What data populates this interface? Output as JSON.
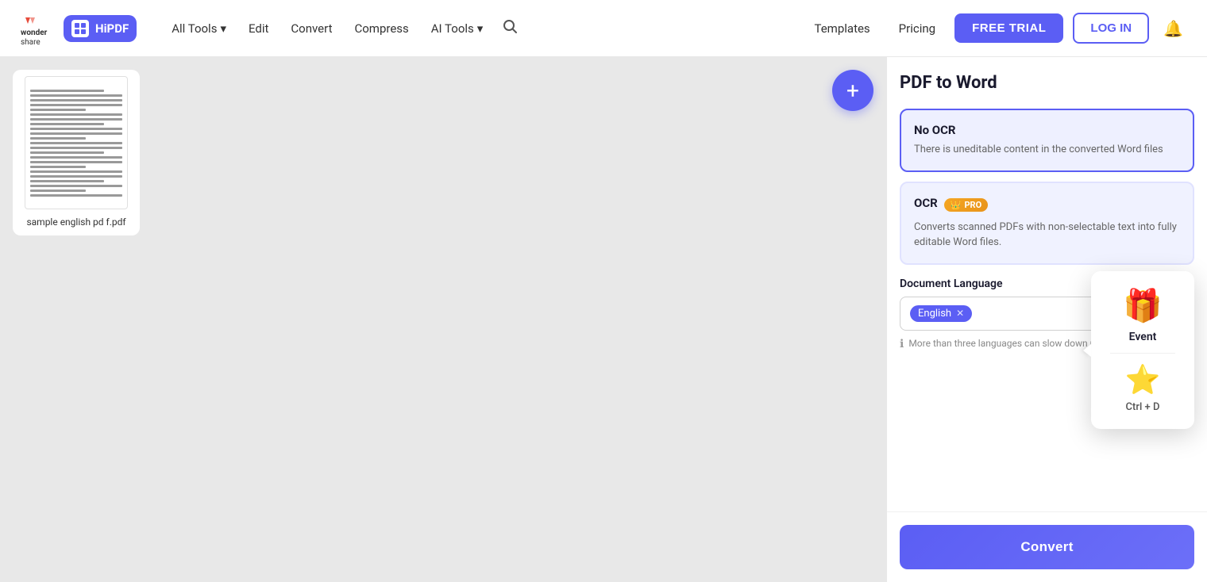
{
  "header": {
    "logo_ws_text": "wondershare",
    "logo_hipdf_text": "HiPDF",
    "nav": {
      "all_tools": "All Tools",
      "edit": "Edit",
      "convert": "Convert",
      "compress": "Compress",
      "ai_tools": "AI Tools"
    },
    "right": {
      "templates": "Templates",
      "pricing": "Pricing",
      "free_trial": "FREE TRIAL",
      "login": "LOG IN"
    }
  },
  "canvas": {
    "add_button_icon": "+",
    "file": {
      "name": "sample english pd f.pdf",
      "lines": [
        {
          "type": "medium"
        },
        {
          "type": "full"
        },
        {
          "type": "full"
        },
        {
          "type": "full"
        },
        {
          "type": "short"
        },
        {
          "type": "full"
        },
        {
          "type": "full"
        },
        {
          "type": "medium"
        },
        {
          "type": "full"
        },
        {
          "type": "full"
        },
        {
          "type": "short"
        },
        {
          "type": "full"
        },
        {
          "type": "full"
        },
        {
          "type": "medium"
        },
        {
          "type": "full"
        },
        {
          "type": "full"
        },
        {
          "type": "full"
        },
        {
          "type": "short"
        },
        {
          "type": "full"
        },
        {
          "type": "full"
        },
        {
          "type": "medium"
        },
        {
          "type": "full"
        },
        {
          "type": "short"
        },
        {
          "type": "full"
        }
      ]
    }
  },
  "sidebar": {
    "title": "PDF to Word",
    "no_ocr_card": {
      "title": "No OCR",
      "description": "There is uneditable content in the converted Word files"
    },
    "ocr_card": {
      "title": "OCR",
      "pro_badge": "PRO",
      "description": "Converts scanned PDFs with non-selectable text into fully editable Word files."
    },
    "document_language": {
      "label": "Document Language",
      "selected_lang": "English",
      "warning": "More than three languages can slow down recognition."
    },
    "convert_button": "Convert"
  },
  "tooltip": {
    "gift_icon": "🎁",
    "event_label": "Event",
    "star_icon": "⭐",
    "shortcut": "Ctrl + D"
  }
}
